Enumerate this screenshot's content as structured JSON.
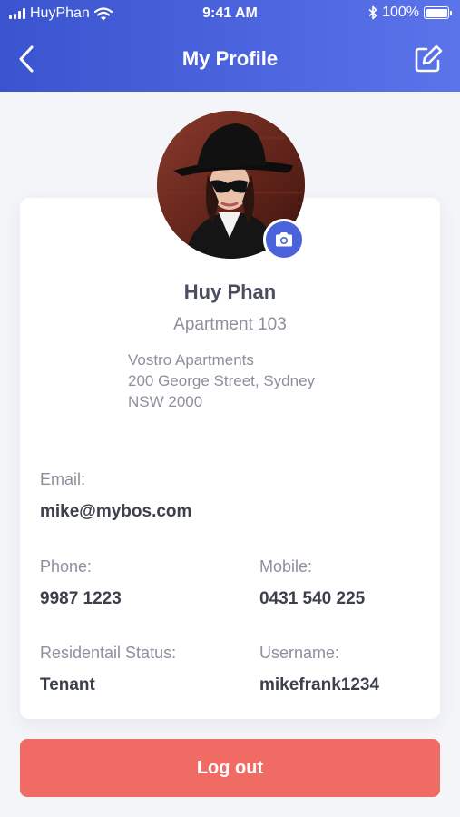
{
  "status_bar": {
    "carrier": "HuyPhan",
    "time": "9:41 AM",
    "battery": "100%",
    "battery_level": 1.0
  },
  "nav": {
    "title": "My Profile",
    "back_icon": "chevron-left-icon",
    "edit_icon": "edit-icon"
  },
  "profile": {
    "name": "Huy Phan",
    "apartment": "Apartment 103",
    "address": [
      "Vostro Apartments",
      "200 George Street, Sydney",
      "NSW 2000"
    ]
  },
  "details": {
    "email_label": "Email:",
    "email": "mike@mybos.com",
    "phone_label": "Phone:",
    "phone": "9987 1223",
    "mobile_label": "Mobile:",
    "mobile": "0431 540 225",
    "status_label": "Residentail Status:",
    "status": "Tenant",
    "username_label": "Username:",
    "username": "mikefrank1234"
  },
  "logout_label": "Log out",
  "colors": {
    "header_start": "#3a54cf",
    "header_end": "#5b74ea",
    "accent": "#4a63dc",
    "logout": "#f06b63"
  }
}
